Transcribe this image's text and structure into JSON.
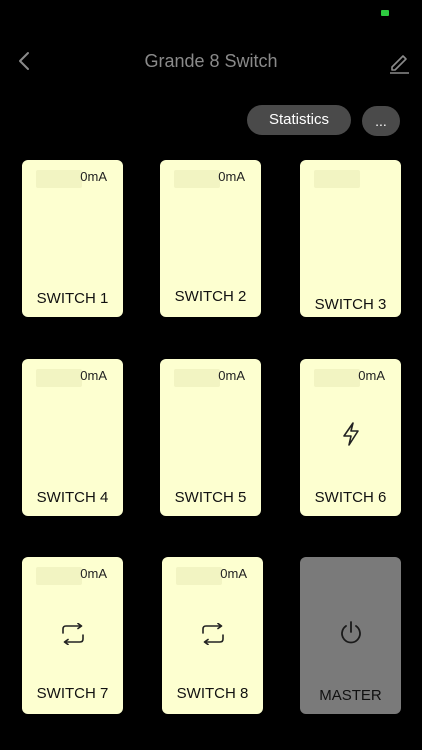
{
  "header": {
    "title": "Grande 8 Switch"
  },
  "actions": {
    "statistics_label": "Statistics",
    "more_label": "..."
  },
  "switches": [
    {
      "label": "SWITCH 1",
      "current": "0mA",
      "icon": null
    },
    {
      "label": "SWITCH 2",
      "current": "0mA",
      "icon": null
    },
    {
      "label": "SWITCH 3",
      "current": "",
      "icon": null
    },
    {
      "label": "SWITCH 4",
      "current": "0mA",
      "icon": null
    },
    {
      "label": "SWITCH 5",
      "current": "0mA",
      "icon": null
    },
    {
      "label": "SWITCH 6",
      "current": "0mA",
      "icon": "lightning-icon"
    },
    {
      "label": "SWITCH 7",
      "current": "0mA",
      "icon": "repeat-icon"
    },
    {
      "label": "SWITCH 8",
      "current": "0mA",
      "icon": "repeat-icon"
    }
  ],
  "master": {
    "label": "MASTER",
    "icon": "power-icon"
  },
  "colors": {
    "background": "#000000",
    "tile": "#fdffd0",
    "master_tile": "#7a7a7a",
    "pill": "#4a4a4a",
    "status_green": "#2ecc40"
  }
}
